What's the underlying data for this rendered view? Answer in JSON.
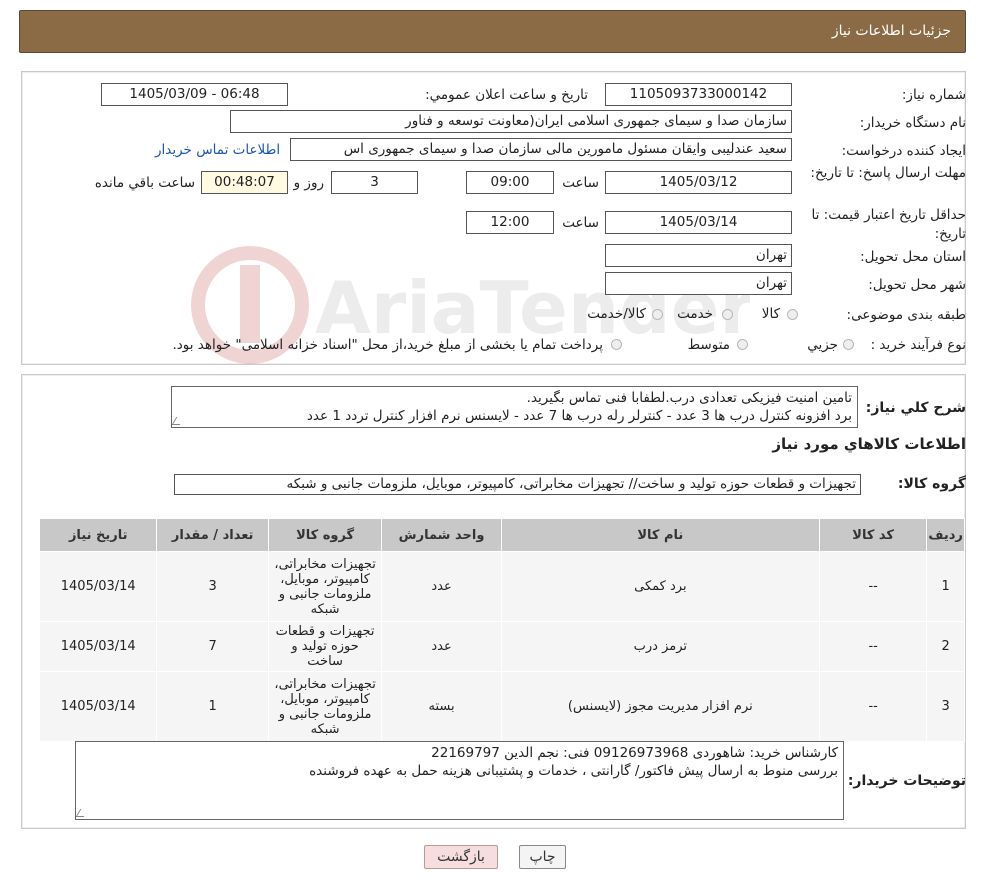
{
  "page_title": "جزئیات اطلاعات نیاز",
  "labels": {
    "need_number": "شماره نیاز:",
    "announce_datetime": "تاريخ و ساعت اعلان عمومي:",
    "buyer_org": "نام دستگاه خريدار:",
    "requester": "ایجاد کننده درخواست:",
    "contact_link": "اطلاعات تماس خریدار",
    "reply_deadline": "مهلت ارسال پاسخ: تا تاریخ:",
    "time_word": "ساعت",
    "days_and": "روز و",
    "remaining": "ساعت باقي مانده",
    "price_validity": "حداقل تاريخ اعتبار قيمت: تا تاريخ:",
    "delivery_province": "استان محل تحويل:",
    "delivery_city": "شهر محل تحويل:",
    "category": "طبقه بندی موضوعی:",
    "process_type": "نوع فرآيند خريد :",
    "general_desc": "شرح کلي نياز:",
    "goods_info": "اطلاعات کالاهاي مورد نياز",
    "goods_group": "گروه کالا:",
    "buyer_notes": "توضیحات خریدار:"
  },
  "fields": {
    "need_number": "1105093733000142",
    "announce_datetime": "1405/03/09 - 06:48",
    "buyer_org": "سازمان صدا و سیمای جمهوری اسلامی ایران(معاونت توسعه و فناور",
    "requester": "سعید عندلیبی وایقان مسئول مامورین مالی  سازمان صدا و سیمای جمهوری اس",
    "reply_date": "1405/03/12",
    "reply_time": "09:00",
    "remaining_days": "3",
    "remaining_time": "00:48:07",
    "validity_date": "1405/03/14",
    "validity_time": "12:00",
    "province": "تهران",
    "city": "تهران"
  },
  "category_options": [
    "کالا",
    "خدمت",
    "کالا/خدمت"
  ],
  "process_options": [
    "جزيي",
    "متوسط"
  ],
  "process_note": "پرداخت تمام یا بخشی از مبلغ خرید،از محل \"اسناد خزانه اسلامی\" خواهد بود.",
  "general_desc_lines": [
    "تامین امنیت فیزیکی تعدادی درب.لطفابا فنی تماس بگیرید.",
    "برد افزونه کنترل درب ها 3 عدد - کنترلر رله درب ها 7 عدد - لایسنس نرم افزار کنترل تردد 1 عدد"
  ],
  "goods_group_value": "تجهیزات و قطعات حوزه تولید و ساخت// تجهیزات مخابراتی، کامپیوتر، موبایل، ملزومات جانبی و شبکه",
  "table": {
    "headers": [
      "رديف",
      "کد کالا",
      "نام کالا",
      "واحد شمارش",
      "گروه کالا",
      "تعداد / مقدار",
      "تاریخ نیاز"
    ],
    "rows": [
      {
        "row": "1",
        "code": "--",
        "name": "برد کمکی",
        "unit": "عدد",
        "group": "تجهیزات مخابراتی، کامپیوتر، موبایل، ملزومات جانبی و شبکه",
        "qty": "3",
        "date": "1405/03/14"
      },
      {
        "row": "2",
        "code": "--",
        "name": "ترمز درب",
        "unit": "عدد",
        "group": "تجهیزات و قطعات حوزه تولید و ساخت",
        "qty": "7",
        "date": "1405/03/14"
      },
      {
        "row": "3",
        "code": "--",
        "name": "نرم افزار مدیریت مجوز (لایسنس)",
        "unit": "بسته",
        "group": "تجهیزات مخابراتی، کامپیوتر، موبایل، ملزومات جانبی و شبکه",
        "qty": "1",
        "date": "1405/03/14"
      }
    ]
  },
  "buyer_notes_lines": [
    "کارشناس خرید: شاهوردی 09126973968  فنی: نجم الدین 22169797",
    "بررسی منوط به ارسال پیش فاکتور/ گارانتی ، خدمات و پشتیبانی هزینه حمل به عهده فروشنده"
  ],
  "buttons": {
    "print": "چاپ",
    "back": "بازگشت"
  },
  "watermark_text": "AriaTender.neT",
  "colors": {
    "titlebar": "#8b6b45",
    "link": "#1a55b3",
    "back_button": "#f7dede"
  }
}
